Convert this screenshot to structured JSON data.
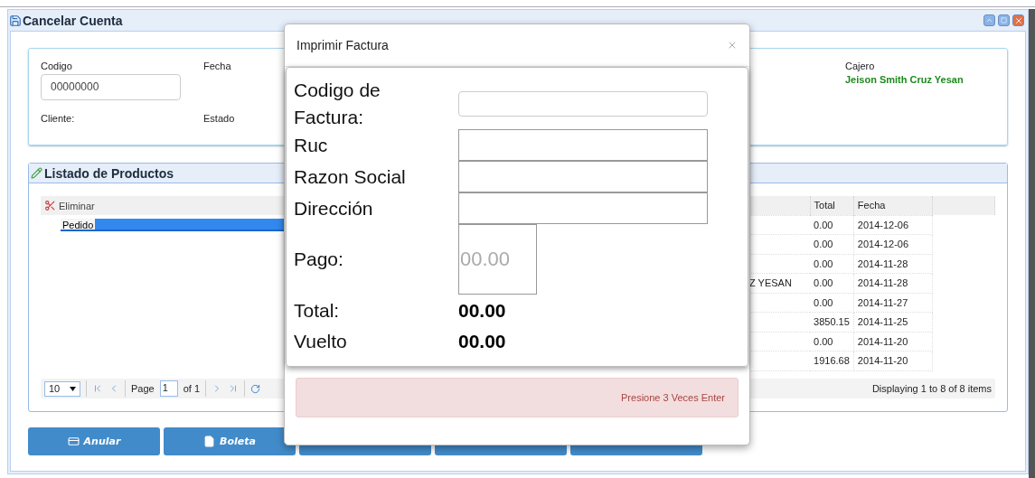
{
  "window": {
    "title": "Cancelar Cuenta"
  },
  "info": {
    "codigo": {
      "label": "Codigo",
      "value": "00000000"
    },
    "fecha": {
      "label": "Fecha"
    },
    "cliente": {
      "label": "Cliente:"
    },
    "estado": {
      "label": "Estado"
    },
    "cajero": {
      "label": "Cajero",
      "value": "Jeison Smith Cruz Yesan"
    }
  },
  "products": {
    "title": "Listado de Productos",
    "toolbar": [
      {
        "label": "Eliminar"
      }
    ],
    "detail_rows": [
      {
        "label": "Pedido",
        "selected": true
      }
    ],
    "columns": [
      {
        "label": "Total"
      },
      {
        "label": "Fecha"
      }
    ],
    "rows": [
      {
        "total": "0.00",
        "fecha": "2014-12-06"
      },
      {
        "total": "0.00",
        "fecha": "2014-12-06"
      },
      {
        "total": "0.00",
        "fecha": "2014-11-28"
      },
      {
        "column_1": "Z YESAN",
        "total": "0.00",
        "fecha": "2014-11-28"
      },
      {
        "total": "0.00",
        "fecha": "2014-11-27"
      },
      {
        "total": "3850.15",
        "fecha": "2014-11-25"
      },
      {
        "total": "0.00",
        "fecha": "2014-11-20"
      },
      {
        "total": "1916.68",
        "fecha": "2014-11-20"
      }
    ],
    "pager": {
      "page_size": "10",
      "page_label": "Page",
      "page": "1",
      "of": "of 1",
      "summary": "Displaying 1 to 8 of 8 items"
    }
  },
  "buttons": [
    {
      "kind": "card",
      "label": "Anular"
    },
    {
      "kind": "file",
      "label": "Boleta"
    },
    {
      "kind": "covered"
    },
    {
      "kind": "covered"
    },
    {
      "kind": "covered"
    }
  ],
  "modal": {
    "title": "Imprimir Factura",
    "fields": [
      {
        "kind": "text",
        "label": "Codigo de Factura:"
      },
      {
        "kind": "box",
        "label": "Ruc"
      },
      {
        "kind": "box",
        "label": "Razon Social"
      },
      {
        "kind": "box",
        "label": "Dirección"
      },
      {
        "kind": "payment",
        "label": "Pago:",
        "placeholder": "00.00"
      },
      {
        "kind": "amount",
        "label": "Total:",
        "value": "00.00"
      },
      {
        "kind": "amount",
        "label": "Vuelto",
        "value": "00.00"
      }
    ],
    "alert": "Presione 3 Veces Enter"
  }
}
